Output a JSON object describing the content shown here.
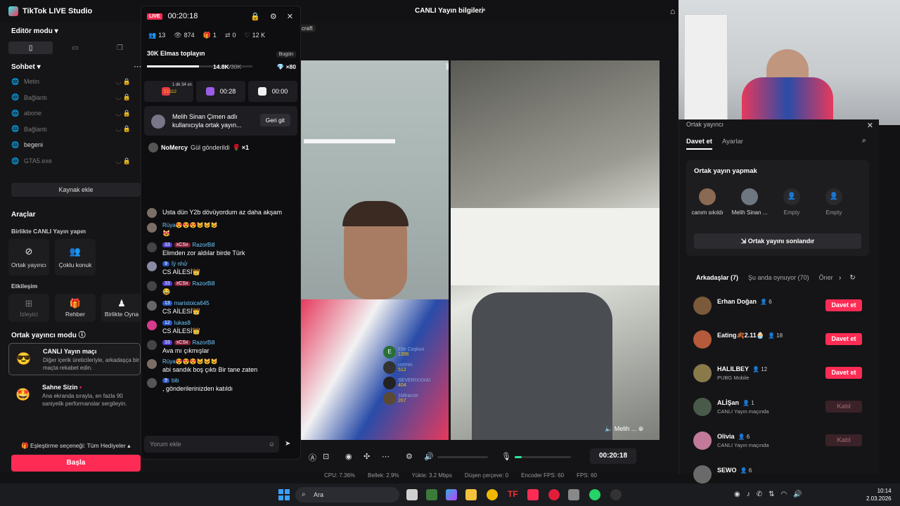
{
  "window": {
    "app_title": "TikTok LIVE Studio",
    "center_title": "CANLI Yayın bilgileri",
    "tag_chip": "craft"
  },
  "left": {
    "editor_mode": "Editör modu",
    "sohbet": "Sohbet",
    "sources": [
      {
        "label": "Metin",
        "bright": false
      },
      {
        "label": "Bağlantı",
        "bright": false
      },
      {
        "label": "abone",
        "bright": false
      },
      {
        "label": "Bağlantı",
        "bright": false
      },
      {
        "label": "begeni",
        "bright": true
      },
      {
        "label": "GTA5.exe",
        "bright": false
      }
    ],
    "add_source": "Kaynak ekle",
    "tools_title": "Araçlar",
    "together_title": "Birlikte CANLI Yayın yapın",
    "tools": [
      {
        "label": "Ortak yayıncı",
        "icon": "link-icon"
      },
      {
        "label": "Çoklu konuk",
        "icon": "people-icon"
      }
    ],
    "interaction_title": "Etkileşim",
    "interaction_tools": [
      {
        "label": "İzleyici",
        "icon": "viewer-icon"
      },
      {
        "label": "Rehber",
        "icon": "gift-icon"
      },
      {
        "label": "Birlikte Oyna",
        "icon": "play-together-icon"
      }
    ],
    "cohost_mode_title": "Ortak yayıncı modu",
    "mode_cards": [
      {
        "title": "CANLI Yayın maçı",
        "desc": "Diğer içerik üreticileriyle, arkadaşça bir maçta rekabet edin.",
        "emoji": "😎"
      },
      {
        "title": "Sahne Sizin",
        "desc": "Ana ekranda sırayla, en fazla 90 saniyelik performanslar sergileyin.",
        "emoji": "🤩"
      }
    ],
    "match_pref": "Eşleştirme seçeneği: Tüm Hediyeler",
    "start_button": "Başla"
  },
  "live": {
    "badge": "LIVE",
    "time": "00:20:18",
    "stats": [
      {
        "icon": "viewers-icon",
        "value": "13"
      },
      {
        "icon": "eye-icon",
        "value": "874"
      },
      {
        "icon": "gift-icon",
        "value": "1"
      },
      {
        "icon": "share-icon",
        "value": "0"
      },
      {
        "icon": "heart-icon",
        "value": "12 K"
      }
    ],
    "goal_title": "30K Elmas toplayın",
    "goal_badge": "Bugün",
    "goal_progress": "14.8K",
    "goal_total": "/30K",
    "goal_fraction": 0.49,
    "goal_mult": "×80",
    "mini_cards": [
      {
        "value": "",
        "sub": "1 dk 34 sn",
        "count": "51/112",
        "color": "#e63946"
      },
      {
        "value": "00:28",
        "sub": "",
        "count": "",
        "color": "#9b5de5"
      },
      {
        "value": "00:00",
        "sub": "",
        "count": "",
        "color": "#f1f1f1"
      }
    ],
    "cohost_text": "Melih Sinan Çimen adlı kullanıcıyla ortak yayın...",
    "cohost_button": "Geri git",
    "gift_notice": {
      "user": "NoMercy",
      "text": "Gül gönderildi",
      "mult": "×1"
    },
    "messages": [
      {
        "avatar": "#7a6e66",
        "level": "",
        "team": "",
        "user": "",
        "text": "Usta dün Y2b dövüyordum az daha akşam"
      },
      {
        "avatar": "#7a6e66",
        "level": "",
        "team": "",
        "user": "Rüya😍😍😍😺😺😺",
        "text": "😻"
      },
      {
        "avatar": "#444",
        "level": "33",
        "team": "xCSx",
        "user": "RazorBill",
        "text": "Elimden zor aldılar birde Türk"
      },
      {
        "avatar": "#8a8aa8",
        "level": "9",
        "team": "",
        "user": "İÿ nhử",
        "text": "CS AİLESİ👑"
      },
      {
        "avatar": "#444",
        "level": "33",
        "team": "xCSx",
        "user": "RazorBill",
        "text": "😂"
      },
      {
        "avatar": "#666",
        "level": "13",
        "team": "",
        "user": "maristoica645",
        "text": "CS AİLESİ👑"
      },
      {
        "avatar": "#d63a8c",
        "level": "12",
        "team": "",
        "user": "lukas8",
        "text": "CS AİLESİ👑"
      },
      {
        "avatar": "#444",
        "level": "33",
        "team": "xCSx",
        "user": "RazorBill",
        "text": "Ava mı çıkmışlar"
      },
      {
        "avatar": "#7a6e66",
        "level": "",
        "team": "",
        "user": "Rüya😍😍😍😺😺😺",
        "text": "abi sandık boş çıktı Bir tane zaten"
      },
      {
        "avatar": "#555",
        "level": "9",
        "team": "",
        "user": "bib",
        "text": ", gönderilerinizden katıldı"
      }
    ],
    "comment_placeholder": "Yorum ekle"
  },
  "stage": {
    "gifts": [
      {
        "name": "Elle Coşkun",
        "count": "1396",
        "letter": "E",
        "color": "#2a6f3a"
      },
      {
        "name": "ustmin",
        "count": "512",
        "letter": "",
        "color": "#333"
      },
      {
        "name": "SEVERIXXXAI",
        "count": "404",
        "letter": "",
        "color": "#222"
      },
      {
        "name": "1Miracstr",
        "count": "267",
        "letter": "",
        "color": "#5a4a33"
      }
    ],
    "cohost_name": "Melih ...",
    "timer": "00:20:18"
  },
  "status": {
    "cpu": "CPU: 7.36%",
    "mem": "Bellek: 2.9%",
    "upload": "Yükle: 3.2 Mbps",
    "dropped": "Düşen çerçeve: 0",
    "encoder_fps": "Encoder FPS: 60",
    "fps": "FPS: 60"
  },
  "right": {
    "panel_title": "Ortak yayıncı",
    "tabs": [
      "Davet et",
      "Ayarlar"
    ],
    "cohost_box_title": "Ortak yayın yapmak",
    "slots": [
      {
        "label": "canım sıkıldı",
        "empty": false,
        "color": "#8a6a52"
      },
      {
        "label": "Melih Sinan ...",
        "empty": false,
        "color": "#6e7680"
      },
      {
        "label": "Empty",
        "empty": true,
        "color": "#2a2a2e"
      },
      {
        "label": "Empty",
        "empty": true,
        "color": "#2a2a2e"
      }
    ],
    "end_button": "Ortak yayını sonlandır",
    "friend_tabs": [
      "Arkadaşlar (7)",
      "Şu anda oynuyor (70)",
      "Öner"
    ],
    "friends": [
      {
        "name": "Erhan Doğan",
        "count": "6",
        "sub": "",
        "button": "Davet et",
        "type": "invite",
        "color": "#7a5a3a"
      },
      {
        "name": "Eating🍂2.11🧁",
        "count": "18",
        "sub": "",
        "button": "Davet et",
        "type": "invite",
        "color": "#b55a3a"
      },
      {
        "name": "HALILBEY",
        "count": "12",
        "sub": "PUBG Mobile",
        "button": "Davet et",
        "type": "invite",
        "color": "#8a7a4a"
      },
      {
        "name": "ALİŞan",
        "count": "1",
        "sub": "CANLI Yayın maçında",
        "button": "Katıl",
        "type": "join",
        "color": "#4a5a4a"
      },
      {
        "name": "Olivia",
        "count": "6",
        "sub": "CANLI Yayın maçında",
        "button": "Katıl",
        "type": "join",
        "color": "#c27a9a"
      },
      {
        "name": "SEWO",
        "count": "6",
        "sub": "",
        "button": "",
        "type": "join",
        "color": "#6a6a6a"
      }
    ]
  },
  "taskbar": {
    "search": "Ara",
    "time": "10:14",
    "date": "2.03.2026"
  }
}
